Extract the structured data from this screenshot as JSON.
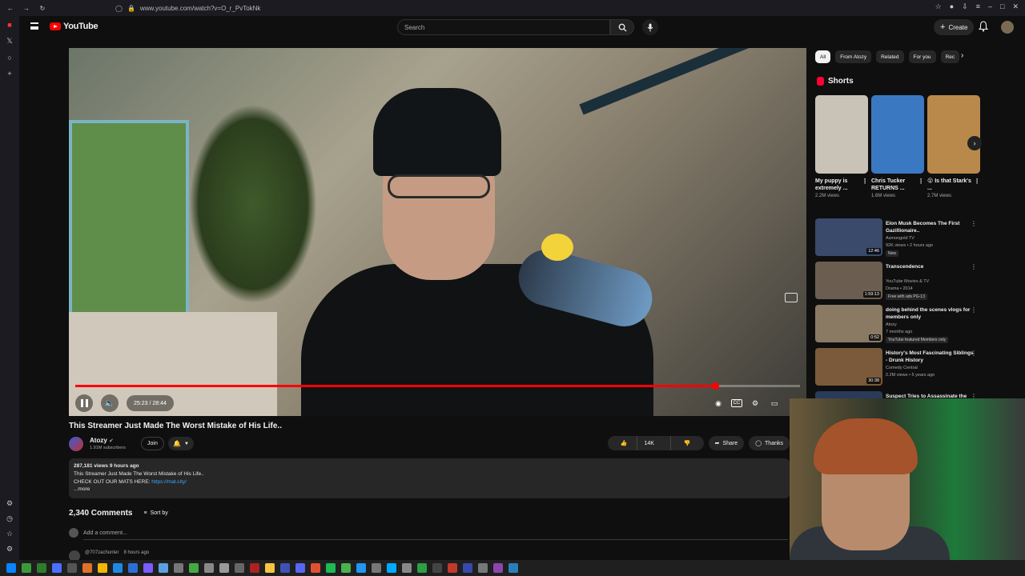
{
  "browser": {
    "url": "www.youtube.com/watch?v=O_r_PvTokNk"
  },
  "header": {
    "logo_text": "YouTube",
    "search_placeholder": "Search",
    "create_label": "Create"
  },
  "player": {
    "time_display": "25:23 / 28:44",
    "progress": 0.883
  },
  "video": {
    "title": "This Streamer Just Made The Worst Mistake of His Life..",
    "channel_name": "Atozy",
    "subscribers": "1.91M subscribers",
    "join_label": "Join",
    "likes": "14K",
    "share_label": "Share",
    "thanks_label": "Thanks"
  },
  "description": {
    "stats": "287,181 views  9 hours ago",
    "line1": "This Streamer Just Made The Worst Mistake of His Life..",
    "line2_prefix": "CHECK OUT OUR MATS HERE: ",
    "line2_link": "https://mat.city/",
    "more": "...more"
  },
  "comments": {
    "count_label": "2,340 Comments",
    "sort_label": "Sort by",
    "add_placeholder": "Add a comment...",
    "next_author": "@707zachunter",
    "next_time": "8 hours ago"
  },
  "chips": [
    "All",
    "From Atozy",
    "Related",
    "For you",
    "Rec"
  ],
  "shorts": {
    "heading": "Shorts",
    "items": [
      {
        "title": "My puppy is extremely ...",
        "views": "2.2M views",
        "color": "#c9c2b6"
      },
      {
        "title": "Chris Tucker RETURNS ...",
        "views": "1.6M views",
        "color": "#3b78c2"
      },
      {
        "title": "😮 Is that Stark's ...",
        "views": "2.7M views",
        "color": "#b9894b"
      }
    ]
  },
  "recommendations": [
    {
      "title": "Elon Musk Becomes The First Gazillionaire..",
      "channel": "Asmongold TV",
      "meta": "92K views • 2 hours ago",
      "badge": "New",
      "duration": "12:46",
      "color": "#3a4a6a"
    },
    {
      "title": "Transcendence",
      "channel": "YouTube Movies & TV",
      "meta": "Drama • 2014",
      "badge": "Free with ads  PG-13",
      "duration": "1:59:13",
      "color": "#6b5e50"
    },
    {
      "title": "doing behind the scenes vlogs for members only",
      "channel": "Atozy",
      "meta": "7 months ago",
      "badge": "YouTube featured   Members only",
      "duration": "0:52",
      "color": "#8a7a63"
    },
    {
      "title": "History's Most Fascinating Siblings - Drunk History",
      "channel": "Comedy Central",
      "meta": "2.2M views • 5 years ago",
      "badge": "",
      "duration": "30:38",
      "color": "#7a5a3a"
    },
    {
      "title": "Suspect Tries to Assassinate the Police Chief",
      "channel": "",
      "meta": "",
      "badge": "",
      "duration": "",
      "color": "#2a3a5a"
    }
  ],
  "colors": {
    "accent": "#ff0000",
    "background": "#0f0f0f",
    "surface": "#272727",
    "link": "#3ea6ff"
  }
}
